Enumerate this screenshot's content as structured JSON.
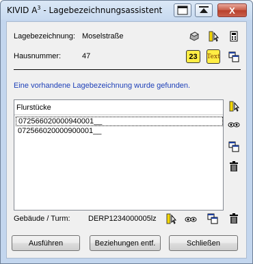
{
  "window": {
    "title_main": "KIVID A",
    "title_sup": "3",
    "title_rest": " - Lagebezeichnungsassistent",
    "close_symbol": "X"
  },
  "fields": {
    "lage_label": "Lagebezeichnung:",
    "lage_value": "Moselstraße",
    "haus_label": "Hausnummer:",
    "haus_value": "47"
  },
  "icons": {
    "number_badge": "23",
    "text_badge": "Text"
  },
  "message": "Eine vorhandene Lagebezeichnung wurde gefunden.",
  "list": {
    "header": "Flurstücke",
    "items": [
      "072566020000940001__",
      "072566020000900001__"
    ]
  },
  "gebaeude": {
    "label": "Gebäude / Turm:",
    "value": "DERP1234000005lz"
  },
  "buttons": {
    "execute": "Ausführen",
    "remove_relations": "Beziehungen entf.",
    "close": "Schließen"
  },
  "colors": {
    "message": "#1d3fb8",
    "badge_yellow": "#ffee44"
  }
}
